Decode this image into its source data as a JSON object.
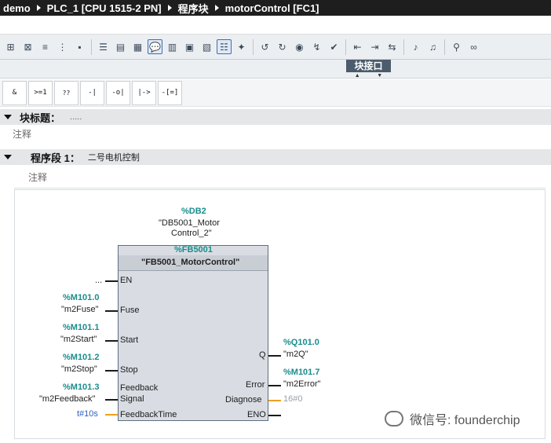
{
  "breadcrumb": {
    "project": "demo",
    "device": "PLC_1 [CPU 1515-2 PN]",
    "folder": "程序块",
    "block": "motorControl [FC1]"
  },
  "toolbar": {
    "icons": [
      "insert-network-icon",
      "delete-network-icon",
      "insert-row-icon",
      "insert-column-icon",
      "open-all-networks-icon",
      "close-all-networks-icon",
      "absolute-symbolic-icon",
      "comments-icon",
      "tag-info-icon",
      "show-favorites-icon",
      "box-call-icon",
      "monitoring-icon",
      "step-over-icon",
      "breakpoint-icon",
      "go-to-icon",
      "next-error-icon",
      "download-icon",
      "online-icon",
      "compare-icon"
    ]
  },
  "interface_tab": {
    "label": "块接口"
  },
  "favorites": [
    {
      "label": "&"
    },
    {
      "label": ">=1"
    },
    {
      "label": "??"
    },
    {
      "label": "-|"
    },
    {
      "label": "-o|"
    },
    {
      "label": "|->"
    },
    {
      "label": "-[=]"
    }
  ],
  "block_title": {
    "label": "块标题：",
    "value": "....."
  },
  "block_comment": "注释",
  "network": {
    "label": "程序段 1：",
    "title": "二号电机控制",
    "comment": "注释",
    "instance_db": {
      "address": "%DB2",
      "name_line1": "\"DB5001_Motor",
      "name_line2": "Control_2\""
    },
    "fb": {
      "address": "%FB5001",
      "name": "\"FB5001_MotorControl\""
    },
    "inputs": [
      {
        "pin": "EN",
        "operand_addr": "",
        "operand_name": "..."
      },
      {
        "pin": "Fuse",
        "operand_addr": "%M101.0",
        "operand_name": "\"m2Fuse\""
      },
      {
        "pin": "Start",
        "operand_addr": "%M101.1",
        "operand_name": "\"m2Start\""
      },
      {
        "pin": "Stop",
        "operand_addr": "%M101.2",
        "operand_name": "\"m2Stop\""
      },
      {
        "pin_line1": "Feedback",
        "pin_line2": "Signal",
        "operand_addr": "%M101.3",
        "operand_name": "\"m2Feedback\""
      },
      {
        "pin": "FeedbackTime",
        "operand_name": "t#10s"
      }
    ],
    "outputs": [
      {
        "pin": "Q",
        "operand_addr": "%Q101.0",
        "operand_name": "\"m2Q\""
      },
      {
        "pin": "Error",
        "operand_addr": "%M101.7",
        "operand_name": "\"m2Error\""
      },
      {
        "pin": "Diagnose",
        "operand_name": "16#0"
      },
      {
        "pin": "ENO"
      }
    ]
  },
  "watermark": "微信号: founderchip",
  "colors": {
    "title_bar": "#1e1e1e",
    "address_teal": "#1a8d8d",
    "literal_blue": "#2a62c0",
    "orange_wire": "#f0a020"
  }
}
